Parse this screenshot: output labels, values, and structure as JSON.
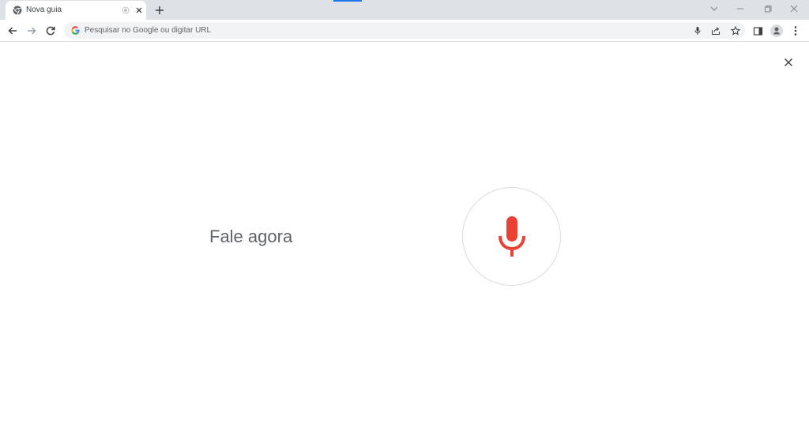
{
  "tab": {
    "title": "Nova guia",
    "favicon": "chrome-icon"
  },
  "window_controls": [
    "tab-search-icon",
    "minimize-icon",
    "restore-icon",
    "close-icon"
  ],
  "toolbar": {
    "omnibox": {
      "placeholder": "Pesquisar no Google ou digitar URL",
      "value": ""
    }
  },
  "voice_search": {
    "prompt": "Fale agora",
    "mic_color": "#ea4335",
    "circle_border": "#dadce0"
  },
  "colors": {
    "tabstrip_bg": "#dee1e6",
    "omnibox_bg": "#f1f3f4",
    "accent": "#1a73e8",
    "text_secondary": "#5f6368"
  }
}
